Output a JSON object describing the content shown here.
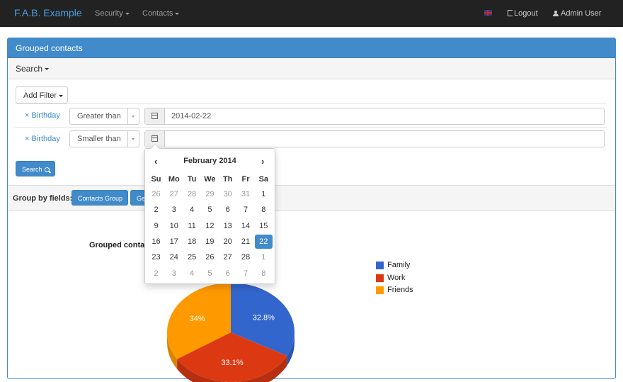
{
  "navbar": {
    "brand": "F.A.B. Example",
    "menus": [
      "Security",
      "Contacts"
    ],
    "logout": "Logout",
    "user": "Admin User"
  },
  "panel": {
    "title": "Grouped contacts",
    "search_toggle": "Search"
  },
  "filters": {
    "add_filter": "Add Filter",
    "rows": [
      {
        "remove": "×",
        "field": "Birthday",
        "operator": "Greater than",
        "value": "2014-02-22"
      },
      {
        "remove": "×",
        "field": "Birthday",
        "operator": "Smaller than",
        "value": ""
      }
    ],
    "search_button": "Search"
  },
  "group_by": {
    "label": "Group by fields:",
    "buttons": [
      "Contacts Group",
      "Ge"
    ]
  },
  "chart_data": {
    "type": "pie",
    "title": "Grouped conta",
    "labels": [
      "Family",
      "Work",
      "Friends"
    ],
    "values": [
      32.8,
      33.1,
      34
    ],
    "value_labels": [
      "32.8%",
      "33.1%",
      "34%"
    ],
    "colors": [
      "#3366cc",
      "#dc3912",
      "#ff9900"
    ],
    "legend_position": "right"
  },
  "datepicker": {
    "prev": "‹",
    "next": "›",
    "title": "February 2014",
    "weekdays": [
      "Su",
      "Mo",
      "Tu",
      "We",
      "Th",
      "Fr",
      "Sa"
    ],
    "weeks": [
      [
        "26",
        "27",
        "28",
        "29",
        "30",
        "31",
        "1"
      ],
      [
        "2",
        "3",
        "4",
        "5",
        "6",
        "7",
        "8"
      ],
      [
        "9",
        "10",
        "11",
        "12",
        "13",
        "14",
        "15"
      ],
      [
        "16",
        "17",
        "18",
        "19",
        "20",
        "21",
        "22"
      ],
      [
        "23",
        "24",
        "25",
        "26",
        "27",
        "28",
        "1"
      ],
      [
        "2",
        "3",
        "4",
        "5",
        "6",
        "7",
        "8"
      ]
    ],
    "selected": "22"
  }
}
